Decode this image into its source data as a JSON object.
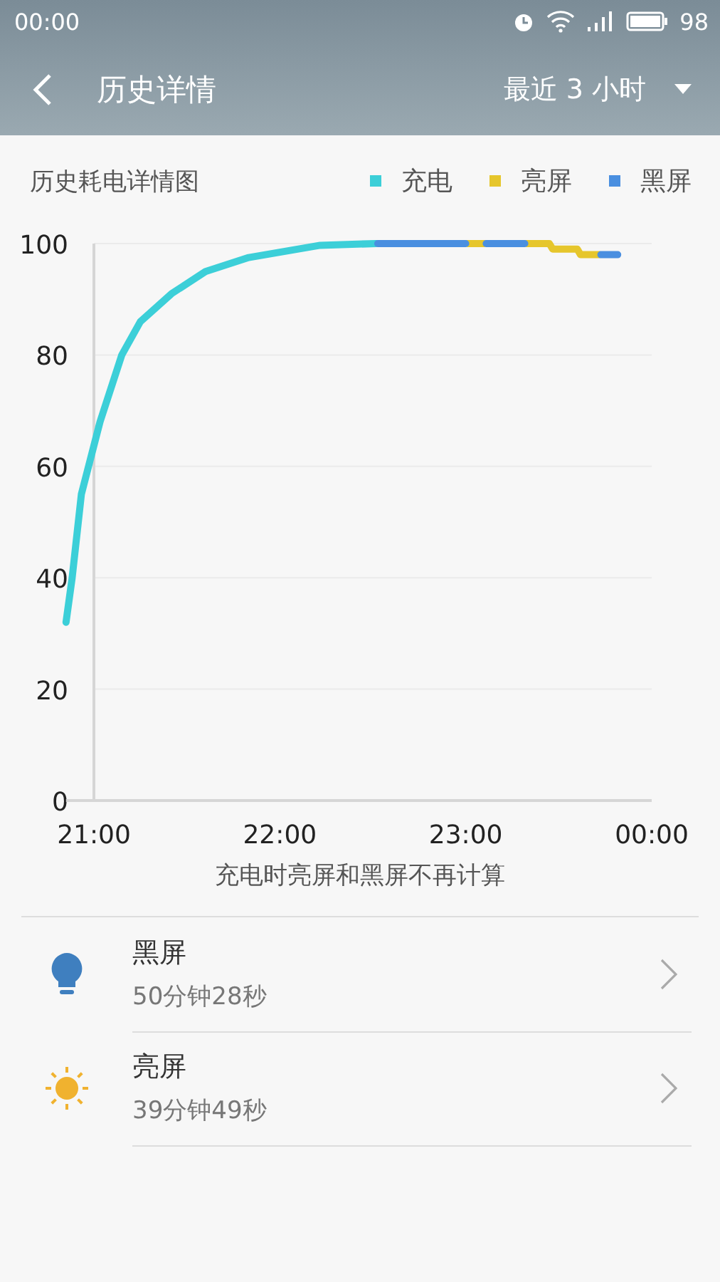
{
  "status_bar": {
    "time": "00:00",
    "battery": "98"
  },
  "header": {
    "title": "历史详情",
    "range": "最近 3 小时"
  },
  "chart_title": "历史耗电详情图",
  "chart_data": {
    "type": "line",
    "grid": true,
    "xlim": [
      20.85,
      24
    ],
    "ylim": [
      0,
      100
    ],
    "xticks": [
      {
        "value": 21,
        "label": "21:00"
      },
      {
        "value": 22,
        "label": "22:00"
      },
      {
        "value": 23,
        "label": "23:00"
      },
      {
        "value": 24,
        "label": "00:00"
      }
    ],
    "yticks": [
      0,
      20,
      40,
      60,
      80,
      100
    ],
    "x": [
      20.85,
      20.883,
      20.933,
      21.033,
      21.15,
      21.25,
      21.417,
      21.6,
      21.833,
      22.217,
      22.517,
      22.527,
      23.0,
      23.01,
      23.1,
      23.11,
      23.317,
      23.327,
      23.45,
      23.467,
      23.6,
      23.617,
      23.717,
      23.727,
      23.817
    ],
    "series": [
      {
        "name": "充电",
        "color": "#3ccfd8",
        "values": [
          32,
          40,
          55,
          68,
          80,
          86,
          91,
          95,
          97.5,
          99.7,
          100,
          null,
          null,
          null,
          null,
          null,
          null,
          null,
          null,
          null,
          null,
          null,
          null,
          null,
          null
        ]
      },
      {
        "name": "亮屏",
        "color": "#e6c62c",
        "values": [
          null,
          null,
          null,
          null,
          null,
          null,
          null,
          null,
          null,
          null,
          null,
          null,
          null,
          100,
          100,
          null,
          null,
          100,
          100,
          99,
          99,
          98,
          98,
          null,
          null
        ]
      },
      {
        "name": "黑屏",
        "color": "#4a8fe0",
        "values": [
          null,
          null,
          null,
          null,
          null,
          null,
          null,
          null,
          null,
          null,
          null,
          100,
          100,
          null,
          null,
          100,
          100,
          null,
          null,
          null,
          null,
          null,
          null,
          98,
          98
        ]
      }
    ]
  },
  "note": "充电时亮屏和黑屏不再计算",
  "items": [
    {
      "kind": "bulb",
      "title": "黑屏",
      "duration": "50分钟28秒"
    },
    {
      "kind": "sun",
      "title": "亮屏",
      "duration": "39分钟49秒"
    }
  ]
}
